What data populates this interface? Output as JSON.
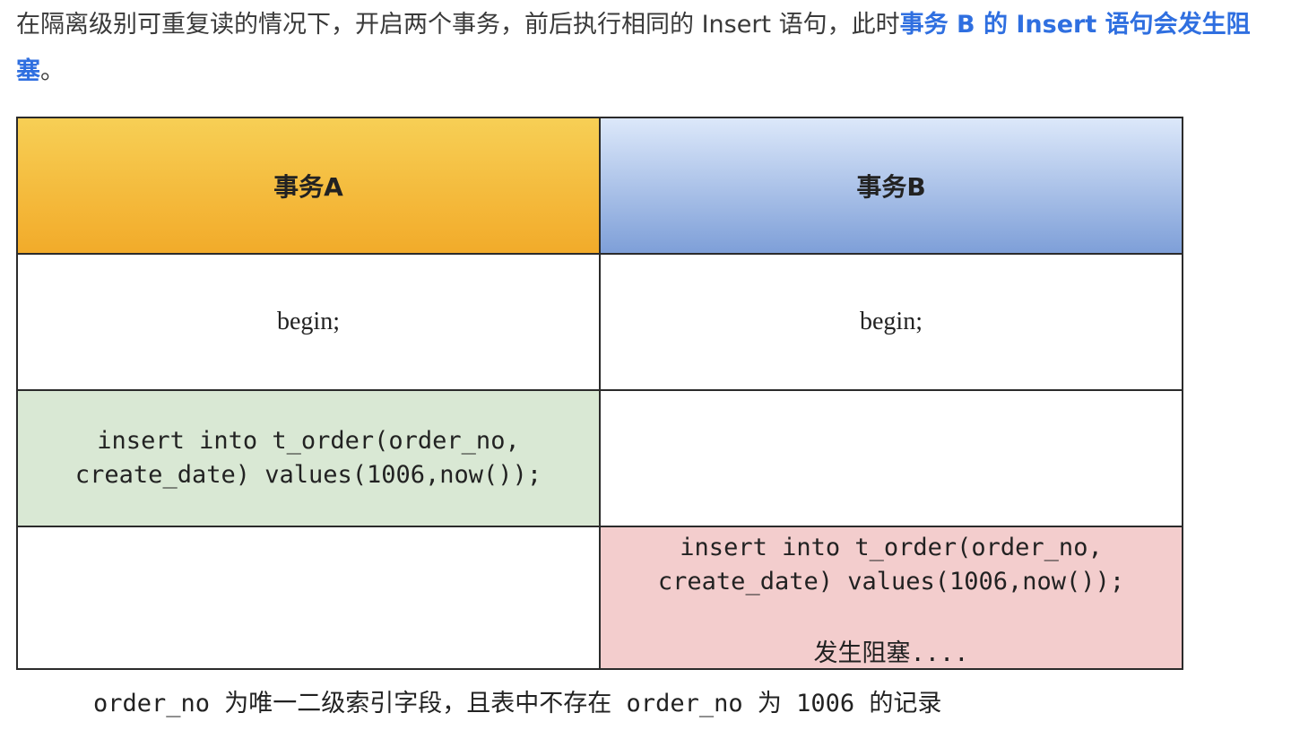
{
  "intro": {
    "text_before": "在隔离级别可重复读的情况下，开启两个事务，前后执行相同的 Insert 语句，此时",
    "highlight": "事务 B 的 Insert 语句会发生阻塞",
    "text_after": "。"
  },
  "table": {
    "headers": [
      "事务A",
      "事务B"
    ],
    "rows": [
      {
        "a": "begin;",
        "b": "begin;"
      },
      {
        "a": "insert into t_order(order_no,\ncreate_date) values(1006,now());",
        "b": ""
      },
      {
        "a": "",
        "b": "insert into t_order(order_no,\ncreate_date) values(1006,now());",
        "b_note": "发生阻塞...."
      }
    ],
    "colors": {
      "header_a": "#f2ab2a",
      "header_b": "#7e9fd8",
      "row_a_insert": "#d9e8d4",
      "row_b_insert": "#f3cdcd"
    }
  },
  "caption": "order_no 为唯一二级索引字段，且表中不存在 order_no 为 1006 的记录"
}
